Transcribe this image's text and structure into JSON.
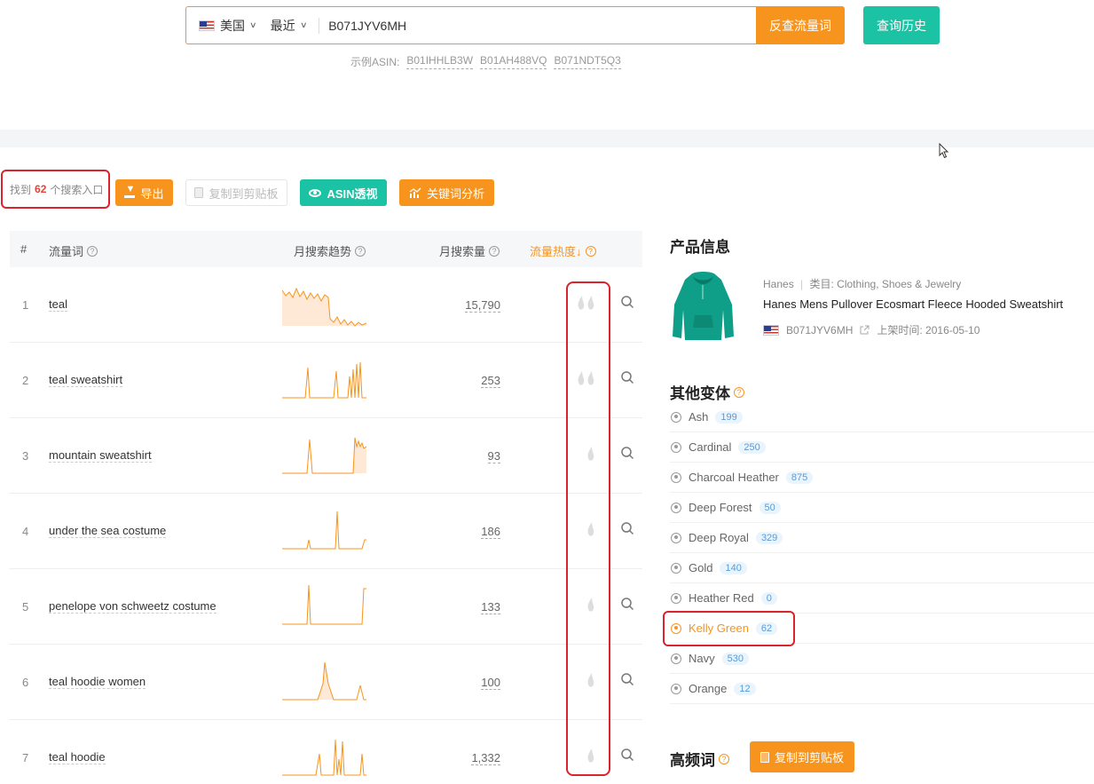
{
  "search": {
    "country": "美国",
    "period": "最近",
    "asin_value": "B071JYV6MH",
    "reverse_button": "反查流量词",
    "history_button": "查询历史",
    "examples_label": "示例ASIN:",
    "examples": [
      "B01IHHLB3W",
      "B01AH488VQ",
      "B071NDT5Q3"
    ]
  },
  "toolbar": {
    "found_prefix": "找到",
    "found_count": "62",
    "found_suffix": "个搜索入口",
    "export": "导出",
    "copy": "复制到剪贴板",
    "asin_view": "ASIN透视",
    "keyword_analysis": "关键词分析"
  },
  "table": {
    "headers": {
      "index": "#",
      "keyword": "流量词",
      "trend": "月搜索趋势",
      "volume": "月搜索量",
      "heat": "流量热度↓"
    },
    "rows": [
      {
        "n": "1",
        "keyword": "teal",
        "volume": "15,790",
        "heat": 2
      },
      {
        "n": "2",
        "keyword": "teal sweatshirt",
        "volume": "253",
        "heat": 2
      },
      {
        "n": "3",
        "keyword": "mountain sweatshirt",
        "volume": "93",
        "heat": 1
      },
      {
        "n": "4",
        "keyword": "under the sea costume",
        "volume": "186",
        "heat": 1
      },
      {
        "n": "5",
        "keyword": "penelope von schweetz costume",
        "volume": "133",
        "heat": 1
      },
      {
        "n": "6",
        "keyword": "teal hoodie women",
        "volume": "100",
        "heat": 1
      },
      {
        "n": "7",
        "keyword": "teal hoodie",
        "volume": "1,332",
        "heat": 1
      }
    ]
  },
  "product": {
    "section_title": "产品信息",
    "brand": "Hanes",
    "category_label": "类目: Clothing, Shoes & Jewelry",
    "title": "Hanes Mens Pullover Ecosmart Fleece Hooded Sweatshirt",
    "asin": "B071JYV6MH",
    "listed": "上架时间: 2016-05-10"
  },
  "variants": {
    "section_title": "其他变体",
    "items": [
      {
        "name": "Ash",
        "count": "199"
      },
      {
        "name": "Cardinal",
        "count": "250"
      },
      {
        "name": "Charcoal Heather",
        "count": "875"
      },
      {
        "name": "Deep Forest",
        "count": "50"
      },
      {
        "name": "Deep Royal",
        "count": "329"
      },
      {
        "name": "Gold",
        "count": "140"
      },
      {
        "name": "Heather Red",
        "count": "0"
      },
      {
        "name": "Kelly Green",
        "count": "62"
      },
      {
        "name": "Navy",
        "count": "530"
      },
      {
        "name": "Orange",
        "count": "12"
      }
    ],
    "active_index": 7
  },
  "high_freq": {
    "section_title": "高频词",
    "copy_button": "复制到剪贴板"
  },
  "colors": {
    "accent_orange": "#f7941d",
    "accent_teal": "#1bc3a4",
    "highlight_red": "#d9232d"
  }
}
